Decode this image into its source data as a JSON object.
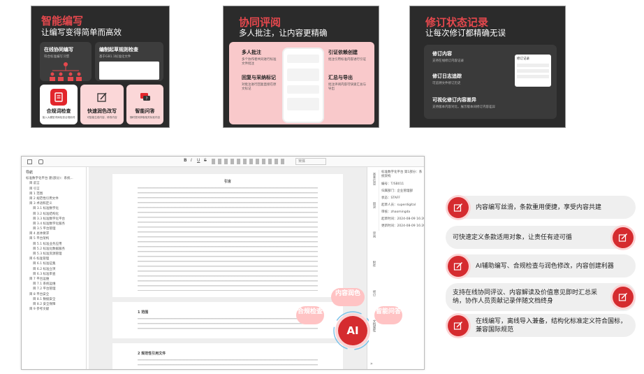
{
  "panel1": {
    "title": "智能编写",
    "subtitle": "让编写变得简单而高效",
    "card1": {
      "title": "在线协同编写",
      "desc": "符合标准编写习惯"
    },
    "card2": {
      "title": "编制起草规则检查",
      "desc": "基于GB1.1标准化文件"
    },
    "card3": {
      "title": "合规词检查",
      "desc": "接入大模型词库检查合规用词"
    },
    "card4": {
      "title": "快速润色改写",
      "desc": "可智能生成内容、修改内容"
    },
    "card5": {
      "title": "智能问答",
      "desc": "随时提问获取相关标准内容"
    }
  },
  "panel2": {
    "title": "协同评阅",
    "subtitle": "多人批注，让内容更精确",
    "item1": {
      "title": "多人批注",
      "desc": "多个协作者共同进行标准文件批注"
    },
    "item2": {
      "title": "回复与采纳标记",
      "desc": "对批注进行回复直接在原文标记"
    },
    "item3": {
      "title": "引证依赖创建",
      "desc": "批注引用标准内容进行引证"
    },
    "item4": {
      "title": "汇总与导出",
      "desc": "批注评阅内容可快速汇总与导出"
    }
  },
  "panel3": {
    "title": "修订状态记录",
    "subtitle": "让每次修订都精确无误",
    "item1": {
      "title": "修订内容",
      "desc": "支持在线修订内容记录"
    },
    "item2": {
      "title": "修订日志追踪",
      "desc": "可追溯文件修订历史"
    },
    "item3": {
      "title": "可视化修订内容差异",
      "desc": "支持版本内容对比，展示版本间修订内容差异"
    },
    "popup": "修订记录"
  },
  "editor": {
    "nav_title": "导航",
    "nav_items": [
      "标准数字化平台 建(部分)：系统...",
      "目 前言",
      "目 引言",
      "目 1 范围",
      "目 2 规范性引用文件",
      "目 3 术语和定义",
      "目 3.1 标准数字化",
      "目 3.2 标准结构化",
      "目 3.3 标准数字化平台",
      "目 3.4 标准数字化服务",
      "目 3.5 平台管理",
      "目 4 总体要求",
      "目 5 平台架构",
      "目 5.1 标准业务应用",
      "目 5.2 标准化数据服务",
      "目 5.3 标准资源管理",
      "目 6 标准管理",
      "目 6.1 标准征集",
      "目 6.2 标准立项",
      "目 6.3 标准审查",
      "目 7 平台运维",
      "目 7.1 系统运维",
      "目 7.2 平台管理",
      "目 8 平台安全",
      "目 8.1 数据安全",
      "目 8.2 安全保障",
      "目 9 参考文献"
    ],
    "page_heading": "引言",
    "section1": "1 范围",
    "section2": "2 规范性引用文件",
    "font_select": "宋体",
    "rightbar_tabs": [
      "基本信息",
      "目录",
      "评阅",
      "附件",
      "修订",
      "文档属性"
    ],
    "meta_title": "标准数字化平台 第1部分：系统架构",
    "meta_rows": [
      "编号：T/SB011",
      "归属部门：企业管理部",
      "状态：STAFF",
      "起草人员：superdigital",
      "审核：zhaomingda",
      "起草时间：2024-08-09 16:20:24",
      "更新时间：2024-08-09 16:20:24"
    ]
  },
  "ai": {
    "center": "AI",
    "bubble_compliance": "合规检查",
    "bubble_content": "内容润色",
    "bubble_qa": "智能问答"
  },
  "features": [
    "内容编写丝滑，条款重用便捷，享受内容共建",
    "可快速定义条款适用对象，让责任有迹可循",
    "AI辅助编写、合规检查与润色修改，内容创建利器",
    "支持在线协同评议、内容解读及价值意见即时汇总采纳，协作人员贡献记录伴随文档终身",
    "在线编写，离线导入兼备，结构化标准定义符合国标，兼容国际规范"
  ],
  "colors": {
    "accent": "#d52b2f",
    "dark_bg": "#2b2b2b",
    "pink": "#fbd7d8"
  }
}
